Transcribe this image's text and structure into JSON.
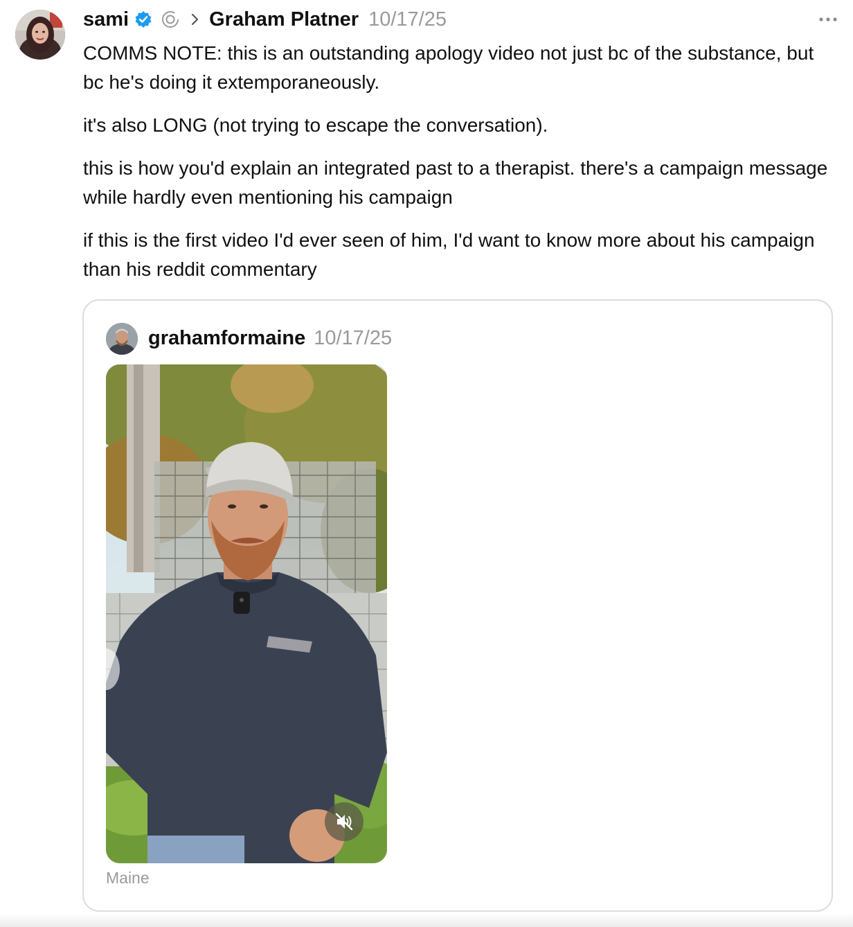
{
  "post": {
    "author": "sami",
    "reply_to": "Graham Platner",
    "date": "10/17/25",
    "paragraphs": [
      "COMMS NOTE: this is an outstanding apology video not just bc of the substance, but bc he's doing it extemporaneously.",
      "it's also LONG (not trying to escape the conversation).",
      "this is how you'd explain an integrated past to a therapist. there's a campaign message while hardly even mentioning his campaign",
      "if this is the first video I'd ever seen of him, I'd want to know more about his campaign than his reddit commentary"
    ]
  },
  "quoted": {
    "author": "grahamformaine",
    "date": "10/17/25",
    "location": "Maine"
  },
  "icons": {
    "verified": "verified-badge-icon",
    "thread": "thread-ring-icon",
    "chevron": "chevron-right-icon",
    "more": "more-dots-icon",
    "mute": "speaker-muted-icon"
  },
  "colors": {
    "verified": "#1d9bf0",
    "muted_text": "#999999",
    "card_border": "#dcdcdc"
  }
}
